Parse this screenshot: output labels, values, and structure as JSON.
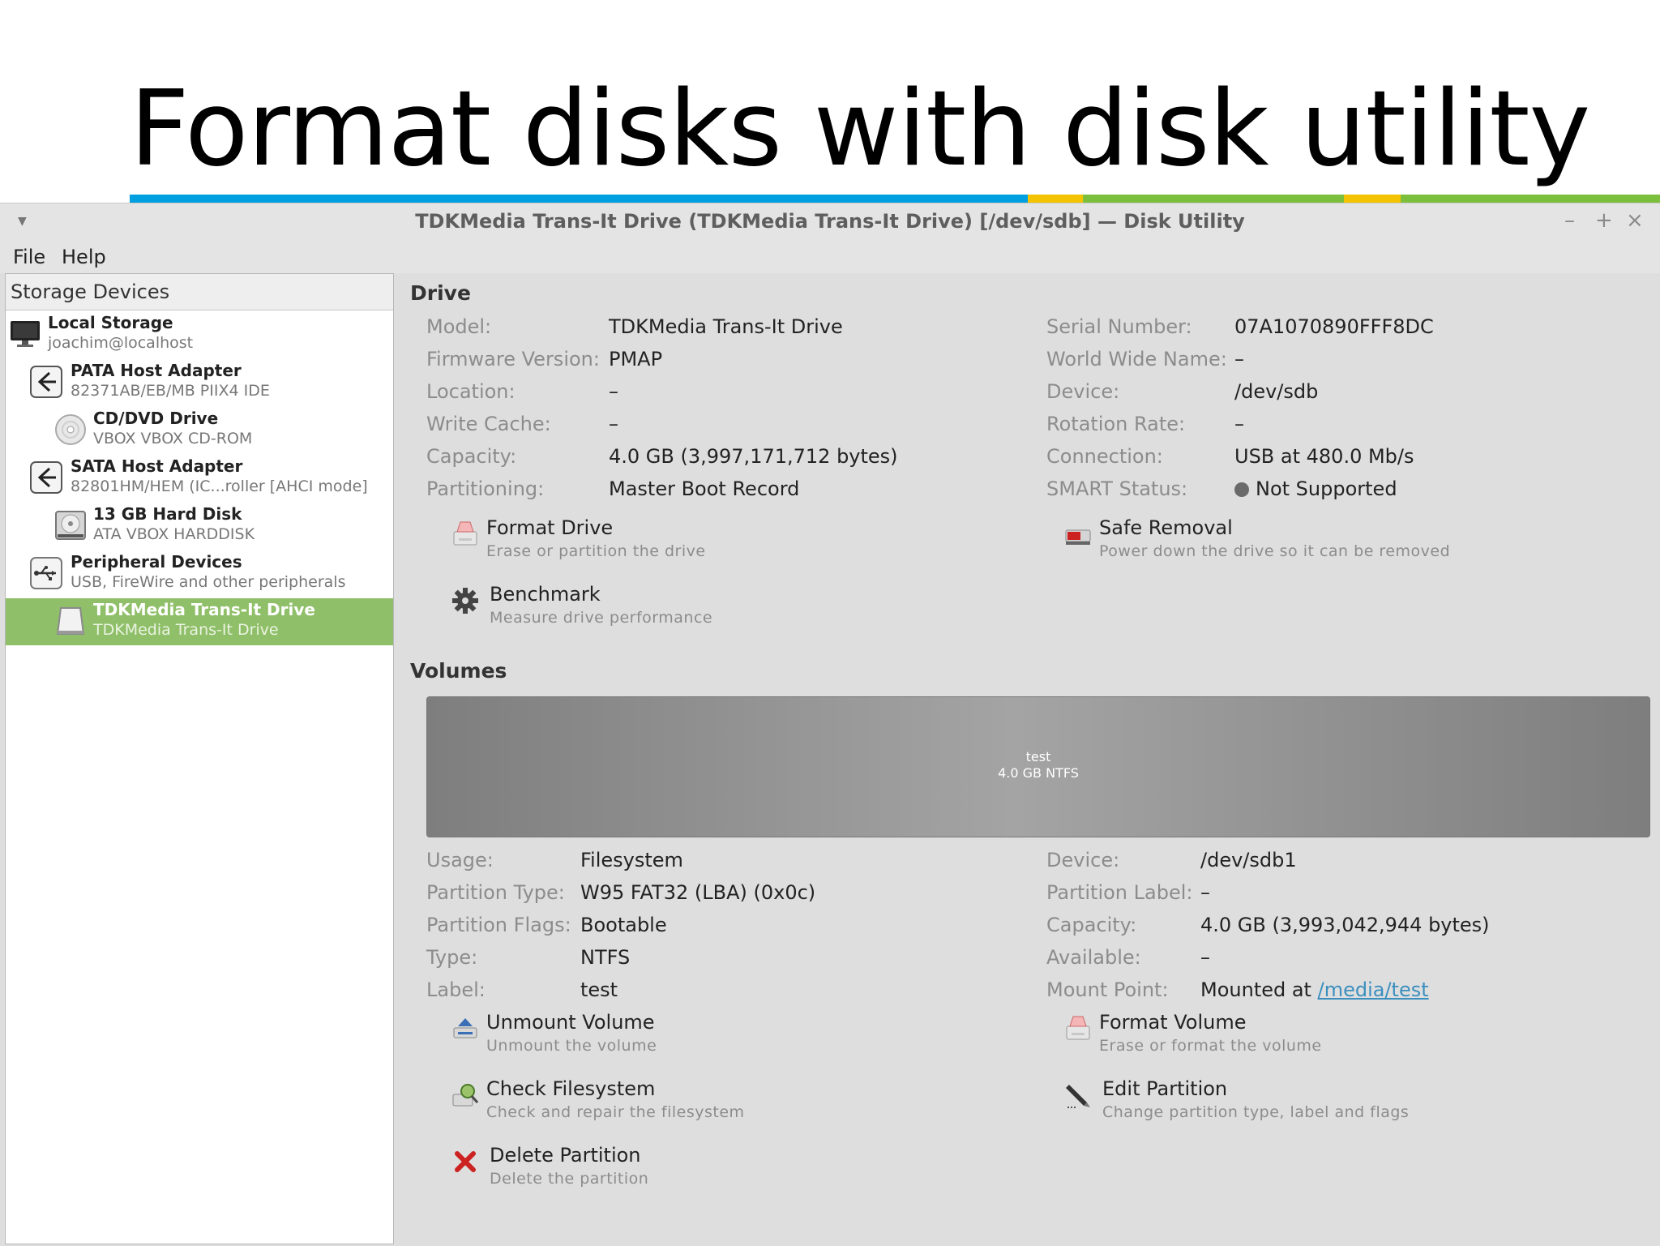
{
  "slide": {
    "title": "Format disks with disk utility",
    "accent_colors": [
      "#00a0e0",
      "#f4c300",
      "#7bbf3d",
      "#f4c300",
      "#7bbf3d"
    ]
  },
  "window": {
    "title": "TDKMedia Trans-It Drive (TDKMedia Trans-It Drive) [/dev/sdb] — Disk Utility",
    "controls": {
      "minimize": "–",
      "maximize": "+",
      "close": "×"
    },
    "menu": [
      "File",
      "Help"
    ]
  },
  "sidebar": {
    "header": "Storage Devices",
    "devices": [
      {
        "name": "Local Storage",
        "sub": "joachim@localhost",
        "icon": "monitor-icon"
      },
      {
        "name": "PATA Host Adapter",
        "sub": "82371AB/EB/MB PIIX4 IDE",
        "icon": "host-adapter-icon"
      },
      {
        "name": "CD/DVD Drive",
        "sub": "VBOX VBOX CD-ROM",
        "icon": "optical-drive-icon"
      },
      {
        "name": "SATA Host Adapter",
        "sub": "82801HM/HEM (IC...roller [AHCI mode]",
        "icon": "host-adapter-icon"
      },
      {
        "name": "13 GB Hard Disk",
        "sub": "ATA VBOX HARDDISK",
        "icon": "hard-disk-icon"
      },
      {
        "name": "Peripheral Devices",
        "sub": "USB, FireWire and other peripherals",
        "icon": "usb-icon"
      },
      {
        "name": "TDKMedia Trans-It Drive",
        "sub": "TDKMedia Trans-It Drive",
        "icon": "removable-drive-icon",
        "selected": true
      }
    ]
  },
  "drive": {
    "section_title": "Drive",
    "left": [
      {
        "label": "Model:",
        "value": "TDKMedia Trans-It Drive"
      },
      {
        "label": "Firmware Version:",
        "value": "PMAP"
      },
      {
        "label": "Location:",
        "value": "–"
      },
      {
        "label": "Write Cache:",
        "value": "–"
      },
      {
        "label": "Capacity:",
        "value": "4.0 GB (3,997,171,712 bytes)"
      },
      {
        "label": "Partitioning:",
        "value": "Master Boot Record"
      }
    ],
    "right": [
      {
        "label": "Serial Number:",
        "value": "07A1070890FFF8DC"
      },
      {
        "label": "World Wide Name:",
        "value": "–"
      },
      {
        "label": "Device:",
        "value": "/dev/sdb"
      },
      {
        "label": "Rotation Rate:",
        "value": "–"
      },
      {
        "label": "Connection:",
        "value": "USB at 480.0 Mb/s"
      },
      {
        "label": "SMART Status:",
        "value": "Not Supported"
      }
    ],
    "actions": {
      "format": {
        "title": "Format Drive",
        "sub": "Erase or partition the drive"
      },
      "safe_removal": {
        "title": "Safe Removal",
        "sub": "Power down the drive so it can be removed"
      },
      "benchmark": {
        "title": "Benchmark",
        "sub": "Measure drive performance"
      }
    }
  },
  "volumes": {
    "section_title": "Volumes",
    "bar": {
      "name": "test",
      "detail": "4.0 GB NTFS"
    },
    "left": [
      {
        "label": "Usage:",
        "value": "Filesystem"
      },
      {
        "label": "Partition Type:",
        "value": "W95 FAT32 (LBA) (0x0c)"
      },
      {
        "label": "Partition Flags:",
        "value": "Bootable"
      },
      {
        "label": "Type:",
        "value": "NTFS"
      },
      {
        "label": "Label:",
        "value": "test"
      }
    ],
    "right": [
      {
        "label": "Device:",
        "value": "/dev/sdb1"
      },
      {
        "label": "Partition Label:",
        "value": "–"
      },
      {
        "label": "Capacity:",
        "value": "4.0 GB (3,993,042,944 bytes)"
      },
      {
        "label": "Available:",
        "value": "–"
      },
      {
        "label": "Mount Point:",
        "value_prefix": "Mounted at ",
        "value_link": "/media/test"
      }
    ],
    "actions": {
      "unmount": {
        "title": "Unmount Volume",
        "sub": "Unmount the volume"
      },
      "format": {
        "title": "Format Volume",
        "sub": "Erase or format the volume"
      },
      "check": {
        "title": "Check Filesystem",
        "sub": "Check and repair the filesystem"
      },
      "edit": {
        "title": "Edit Partition",
        "sub": "Change partition type, label and flags"
      },
      "delete": {
        "title": "Delete Partition",
        "sub": "Delete the partition"
      }
    }
  },
  "colors": {
    "selection": "#8fbf68",
    "link": "#3a8fbf",
    "delete": "#cc2222"
  }
}
